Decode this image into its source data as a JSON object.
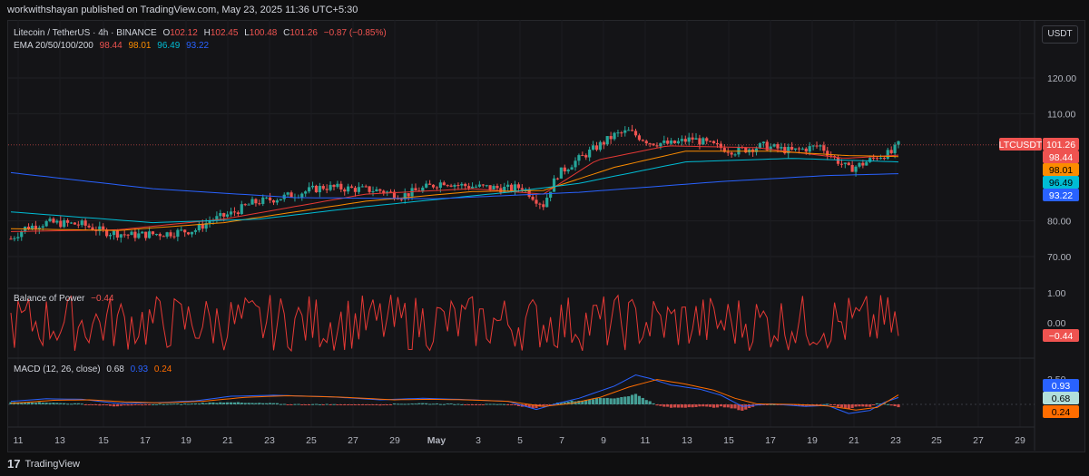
{
  "header": {
    "publisher": "workwithshayan published on TradingView.com, May 23, 2025 11:36 UTC+5:30"
  },
  "footer": {
    "brand_mark": "17",
    "brand": "TradingView"
  },
  "currency_button": "USDT",
  "colors": {
    "up": "#26a69a",
    "down": "#ef5350",
    "ema20": "#e53935",
    "ema50": "#fb8c00",
    "ema100": "#00bcd4",
    "ema200": "#2962ff",
    "bop": "#e53935",
    "macd": "#2962ff",
    "signal": "#ff6d00"
  },
  "legend": {
    "symbol": "Litecoin / TetherUS · 4h · BINANCE",
    "o_label": "O",
    "o": "102.12",
    "h_label": "H",
    "h": "102.45",
    "l_label": "L",
    "l": "100.48",
    "c_label": "C",
    "c": "101.26",
    "change": "−0.87 (−0.85%)",
    "ema_name": "EMA 20/50/100/200",
    "ema20": "98.44",
    "ema50": "98.01",
    "ema100": "96.49",
    "ema200": "93.22"
  },
  "bop_legend": {
    "name": "Balance of Power",
    "value": "−0.44"
  },
  "macd_legend": {
    "name": "MACD (12, 26, close)",
    "macd": "0.68",
    "signal": "0.93",
    "hist": "0.24"
  },
  "price_tags": {
    "symbol": "LTCUSDT",
    "last": "101.26",
    "ema20": "98.44",
    "ema50": "98.01",
    "ema100": "96.49",
    "ema200": "93.22"
  },
  "bop_tag": "−0.44",
  "macd_tags": {
    "signal": "0.93",
    "macd": "0.68",
    "hist": "0.24"
  },
  "chart_data": [
    {
      "type": "candlestick",
      "title": "Litecoin / TetherUS · 4h · BINANCE",
      "x_ticks": [
        "11",
        "13",
        "15",
        "17",
        "19",
        "21",
        "23",
        "25",
        "27",
        "29",
        "May",
        "3",
        "5",
        "7",
        "9",
        "11",
        "13",
        "15",
        "17",
        "19",
        "21",
        "23",
        "25",
        "27",
        "29"
      ],
      "y_ticks": [
        "120.00",
        "110.00",
        "80.00",
        "70.00"
      ],
      "ylim": [
        64,
        128
      ],
      "anchors_close": [
        [
          0,
          75
        ],
        [
          4,
          78
        ],
        [
          10,
          79.5
        ],
        [
          20,
          79
        ],
        [
          26,
          77
        ],
        [
          34,
          76
        ],
        [
          44,
          76.5
        ],
        [
          52,
          77.5
        ],
        [
          56,
          80
        ],
        [
          62,
          82
        ],
        [
          68,
          85
        ],
        [
          76,
          86.5
        ],
        [
          82,
          88
        ],
        [
          88,
          89.5
        ],
        [
          96,
          89
        ],
        [
          104,
          88.5
        ],
        [
          110,
          87
        ],
        [
          116,
          89
        ],
        [
          122,
          91
        ],
        [
          126,
          90
        ],
        [
          132,
          89.5
        ],
        [
          140,
          89
        ],
        [
          144,
          89.5
        ],
        [
          148,
          86
        ],
        [
          150,
          84.5
        ],
        [
          152,
          89
        ],
        [
          154,
          93
        ],
        [
          158,
          96
        ],
        [
          164,
          100
        ],
        [
          170,
          104
        ],
        [
          174,
          105
        ],
        [
          180,
          102
        ],
        [
          186,
          101.5
        ],
        [
          192,
          103
        ],
        [
          198,
          101
        ],
        [
          204,
          99.5
        ],
        [
          212,
          101
        ],
        [
          220,
          99.5
        ],
        [
          228,
          101
        ],
        [
          232,
          97.5
        ],
        [
          236,
          94.5
        ],
        [
          240,
          96
        ],
        [
          244,
          98
        ],
        [
          248,
          99
        ],
        [
          250,
          101.3
        ]
      ],
      "series": [
        {
          "name": "EMA 20",
          "anchors": [
            [
              0,
              77
            ],
            [
              30,
              77.5
            ],
            [
              60,
              80.5
            ],
            [
              100,
              87.5
            ],
            [
              130,
              89
            ],
            [
              150,
              87.5
            ],
            [
              165,
              97
            ],
            [
              185,
              101
            ],
            [
              210,
              100.5
            ],
            [
              235,
              97.5
            ],
            [
              250,
              98.4
            ]
          ]
        },
        {
          "name": "EMA 50",
          "anchors": [
            [
              0,
              77.8
            ],
            [
              30,
              77.3
            ],
            [
              60,
              79.5
            ],
            [
              100,
              85.5
            ],
            [
              130,
              88.2
            ],
            [
              150,
              88.5
            ],
            [
              170,
              95
            ],
            [
              190,
              99.5
            ],
            [
              215,
              99.5
            ],
            [
              235,
              98.3
            ],
            [
              250,
              98.0
            ]
          ]
        },
        {
          "name": "EMA 100",
          "anchors": [
            [
              0,
              82.5
            ],
            [
              40,
              79.5
            ],
            [
              70,
              80.5
            ],
            [
              100,
              84
            ],
            [
              140,
              88
            ],
            [
              160,
              90.5
            ],
            [
              190,
              96.5
            ],
            [
              220,
              97.5
            ],
            [
              250,
              96.5
            ]
          ]
        },
        {
          "name": "EMA 200",
          "anchors": [
            [
              0,
              93.5
            ],
            [
              40,
              89
            ],
            [
              80,
              86.5
            ],
            [
              120,
              86.2
            ],
            [
              160,
              88
            ],
            [
              200,
              91
            ],
            [
              230,
              92.7
            ],
            [
              250,
              93.2
            ]
          ]
        }
      ]
    },
    {
      "type": "line",
      "title": "Balance of Power",
      "y_ticks": [
        "1.00",
        "0.00"
      ],
      "ylim": [
        -1.05,
        1.2
      ],
      "last": -0.44
    },
    {
      "type": "line+bar",
      "title": "MACD (12, 26, close)",
      "y_ticks": [
        "2.50"
      ],
      "ylim": [
        -1.6,
        3.3
      ],
      "series": [
        {
          "name": "MACD",
          "anchors": [
            [
              0,
              0.3
            ],
            [
              10,
              0.55
            ],
            [
              20,
              0.5
            ],
            [
              30,
              0.1
            ],
            [
              40,
              0.15
            ],
            [
              52,
              0.35
            ],
            [
              62,
              0.8
            ],
            [
              74,
              0.9
            ],
            [
              90,
              0.75
            ],
            [
              104,
              0.45
            ],
            [
              116,
              0.6
            ],
            [
              126,
              0.5
            ],
            [
              140,
              0.3
            ],
            [
              148,
              -0.5
            ],
            [
              154,
              0.1
            ],
            [
              160,
              0.6
            ],
            [
              170,
              1.8
            ],
            [
              176,
              2.9
            ],
            [
              180,
              2.55
            ],
            [
              186,
              1.9
            ],
            [
              194,
              1.5
            ],
            [
              200,
              0.9
            ],
            [
              206,
              -0.2
            ],
            [
              214,
              0.05
            ],
            [
              224,
              -0.2
            ],
            [
              230,
              -0.1
            ],
            [
              236,
              -0.9
            ],
            [
              242,
              -0.6
            ],
            [
              246,
              0.2
            ],
            [
              250,
              0.68
            ]
          ]
        },
        {
          "name": "Signal",
          "anchors": [
            [
              0,
              0.1
            ],
            [
              12,
              0.4
            ],
            [
              22,
              0.45
            ],
            [
              32,
              0.25
            ],
            [
              42,
              0.15
            ],
            [
              54,
              0.3
            ],
            [
              66,
              0.7
            ],
            [
              78,
              0.85
            ],
            [
              94,
              0.7
            ],
            [
              108,
              0.45
            ],
            [
              118,
              0.5
            ],
            [
              128,
              0.45
            ],
            [
              140,
              0.3
            ],
            [
              150,
              -0.2
            ],
            [
              158,
              0.1
            ],
            [
              166,
              0.7
            ],
            [
              174,
              1.7
            ],
            [
              182,
              2.45
            ],
            [
              190,
              2.0
            ],
            [
              198,
              1.4
            ],
            [
              204,
              0.6
            ],
            [
              210,
              0.05
            ],
            [
              220,
              0.0
            ],
            [
              230,
              -0.15
            ],
            [
              238,
              -0.55
            ],
            [
              244,
              -0.3
            ],
            [
              250,
              0.93
            ]
          ]
        }
      ]
    }
  ]
}
